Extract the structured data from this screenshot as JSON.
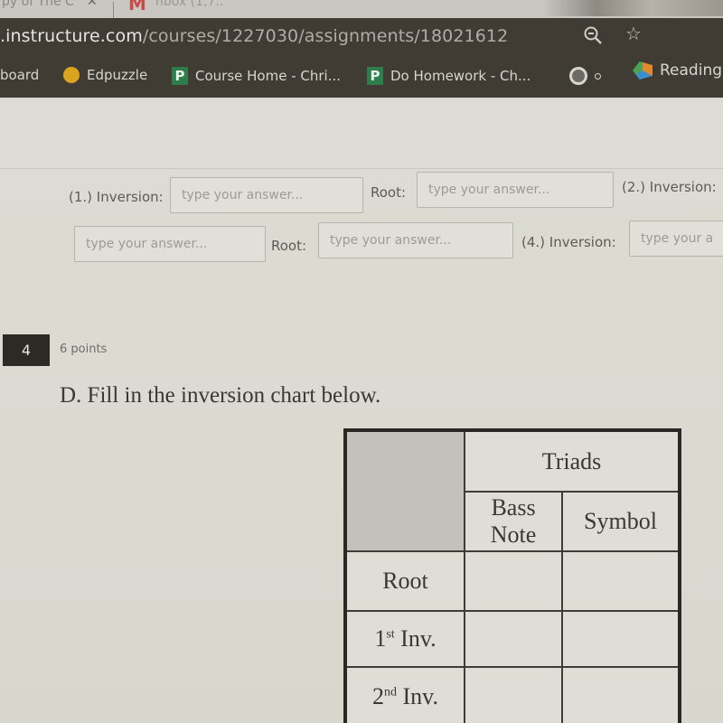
{
  "browser": {
    "tabs": [
      {
        "title": "py of The C",
        "close_glyph": "✕"
      },
      {
        "title": "nbox (1,7..",
        "icon": "gmail-icon"
      }
    ],
    "url_host": ".instructure.com",
    "url_path": "/courses/1227030/assignments/18021612",
    "bookmarks": [
      {
        "label": "board",
        "icon": null
      },
      {
        "label": "Edpuzzle",
        "icon": "edpuzzle-icon"
      },
      {
        "label": "Course Home - Chri...",
        "icon": "pearson-p-icon",
        "icon_text": "P"
      },
      {
        "label": "Do Homework - Ch...",
        "icon": "pearson-p-icon",
        "icon_text": "P"
      },
      {
        "label": "",
        "icon": "globe-icon"
      },
      {
        "label": "Reading",
        "icon": "reading-icon"
      }
    ]
  },
  "fields_row1": [
    {
      "label": "(1.) Inversion:",
      "placeholder": "type your answer..."
    },
    {
      "label": "Root:",
      "placeholder": "type your answer..."
    },
    {
      "label": "(2.) Inversion:",
      "placeholder": ""
    }
  ],
  "fields_row2": [
    {
      "label": "",
      "placeholder": "type your answer..."
    },
    {
      "label": "Root:",
      "placeholder": "type your answer..."
    },
    {
      "label": "(4.) Inversion:",
      "placeholder": "type your a"
    }
  ],
  "question": {
    "number": "4",
    "points": "6 points",
    "text": "D.  Fill in the inversion chart below."
  },
  "chart": {
    "group_header": "Triads",
    "col_headers": [
      "Bass Note",
      "Symbol"
    ],
    "bass_line1": "Bass",
    "bass_line2": "Note",
    "rows": [
      {
        "label": "Root",
        "num": "",
        "sup": "",
        "rest": "Root"
      },
      {
        "label": "1st Inv.",
        "num": "1",
        "sup": "st",
        "rest": " Inv."
      },
      {
        "label": "2nd Inv.",
        "num": "2",
        "sup": "nd",
        "rest": " Inv."
      }
    ]
  }
}
